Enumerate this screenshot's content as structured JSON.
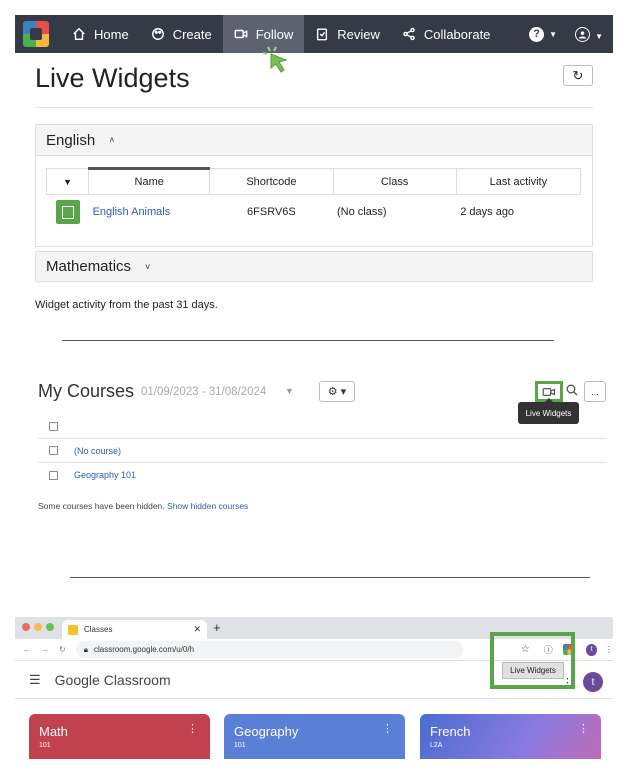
{
  "navbar": {
    "items": [
      {
        "label": "Home",
        "icon": "home-icon"
      },
      {
        "label": "Create",
        "icon": "palette-icon"
      },
      {
        "label": "Follow",
        "icon": "video-icon",
        "active": true
      },
      {
        "label": "Review",
        "icon": "clipboard-icon"
      },
      {
        "label": "Collaborate",
        "icon": "share-icon"
      }
    ],
    "help_icon": "?",
    "colors": {
      "bg": "#343a46",
      "active": "#5c6270"
    }
  },
  "page": {
    "title": "Live Widgets",
    "refresh_icon": "↻"
  },
  "english_panel": {
    "heading": "English",
    "chevron": "˄",
    "columns": [
      "Name",
      "Shortcode",
      "Class",
      "Last activity"
    ],
    "rows": [
      {
        "name": "English Animals",
        "shortcode": "6FSRV6S",
        "class": "(No class)",
        "last_activity": "2 days ago"
      }
    ]
  },
  "math_panel": {
    "heading": "Mathematics",
    "chevron": "˅"
  },
  "activity_note": "Widget activity from the past 31 days.",
  "courses": {
    "title": "My Courses",
    "date_range": "01/09/2023 - 31/08/2024",
    "rows": [
      "(No course)",
      "Geography 101"
    ],
    "hidden_note": "Some courses have been hidden.",
    "show_hidden_link": "Show hidden courses",
    "more_label": "...",
    "tooltip": "Live Widgets"
  },
  "browser": {
    "tab_title": "Classes",
    "url": "classroom.google.com/u/0/h",
    "app_name_prefix": "Google",
    "app_name": "Classroom",
    "extension_menu_label": "Live Widgets",
    "avatar_letter": "t",
    "cards": [
      {
        "name": "Math",
        "sub": "101",
        "color": "#c2414f"
      },
      {
        "name": "Geography",
        "sub": "101",
        "color": "#5a7fd6"
      },
      {
        "name": "French",
        "sub": "L2A",
        "color": "#5c6fc9"
      }
    ]
  },
  "accent_green": "#5aa549"
}
